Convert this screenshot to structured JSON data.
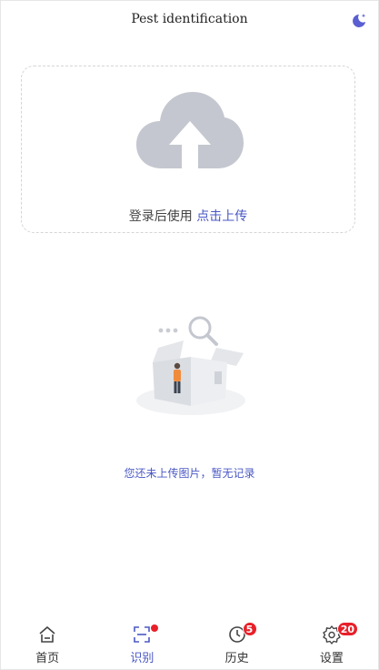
{
  "header": {
    "title": "Pest identification",
    "theme_icon": "moon-star-icon"
  },
  "upload": {
    "prompt": "登录后使用",
    "link": "点击上传",
    "icon": "cloud-upload-icon"
  },
  "empty_state": {
    "message": "您还未上传图片，暂无记录",
    "icon": "empty-box-search-icon"
  },
  "tabbar": {
    "accent_color": "#4a58c4",
    "items": [
      {
        "label": "首页",
        "icon": "home-icon",
        "active": false
      },
      {
        "label": "识别",
        "icon": "scan-icon",
        "active": true,
        "dot": true
      },
      {
        "label": "历史",
        "icon": "history-clock-icon",
        "active": false,
        "badge": "5"
      },
      {
        "label": "设置",
        "icon": "settings-gear-icon",
        "active": false,
        "badge": "20"
      }
    ]
  }
}
